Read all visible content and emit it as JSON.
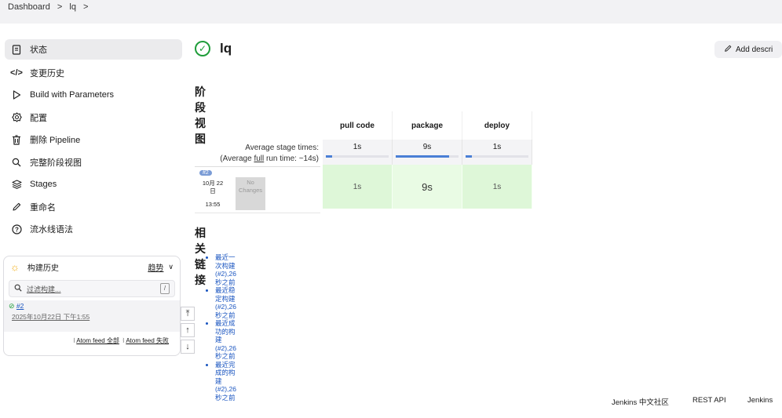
{
  "breadcrumbs": [
    "Dashboard",
    ">",
    "lq",
    ">"
  ],
  "sidebar": {
    "items": [
      {
        "icon": "document-icon",
        "label": "状态"
      },
      {
        "icon": "code-icon",
        "label": "变更历史"
      },
      {
        "icon": "play-icon",
        "label": "Build with Parameters"
      },
      {
        "icon": "gear-icon",
        "label": "配置"
      },
      {
        "icon": "trash-icon",
        "label": "删除 Pipeline"
      },
      {
        "icon": "search-icon",
        "label": "完整阶段视图"
      },
      {
        "icon": "layers-icon",
        "label": "Stages"
      },
      {
        "icon": "pencil-icon",
        "label": "重命名"
      },
      {
        "icon": "help-icon",
        "label": "流水线语法"
      }
    ]
  },
  "history": {
    "title": "构建历史",
    "trend": "趋势",
    "filter_placeholder": "过滤构建...",
    "shortcut": "/",
    "build": {
      "number": "#2",
      "date": "2025年10月22日 下午1:55"
    },
    "feed_all": "Atom feed 全部",
    "feed_failed": "Atom feed 失败"
  },
  "job": {
    "name": "lq",
    "add_description": "Add descri"
  },
  "stage_view": {
    "heading": "阶段视图",
    "avg_label": "Average stage times:",
    "avg_run_prefix": "(Average ",
    "avg_run_link": "full",
    "avg_run_suffix": " run time: ~14s)",
    "build": {
      "badge": "#2",
      "date_line1": "10月 22",
      "date_line2": "日",
      "time": "13:55",
      "no_changes_1": "No",
      "no_changes_2": "Changes"
    },
    "stages": [
      {
        "name": "pull code",
        "avg": "1s",
        "cell": "1s",
        "progress": 0.1,
        "strong": false
      },
      {
        "name": "package",
        "avg": "9s",
        "cell": "9s",
        "progress": 0.85,
        "strong": true
      },
      {
        "name": "deploy",
        "avg": "1s",
        "cell": "1s",
        "progress": 0.1,
        "strong": false
      }
    ]
  },
  "related": {
    "heading": "相关链接",
    "links": [
      "最近一次构建(#2),26 秒之前",
      "最近稳定构建(#2),26 秒之前",
      "最近成功的构建(#2),26 秒之前",
      "最近完成的构建(#2),26 秒之前"
    ]
  },
  "footer": {
    "community": "Jenkins 中文社区",
    "rest": "REST API",
    "version": "Jenkins"
  }
}
